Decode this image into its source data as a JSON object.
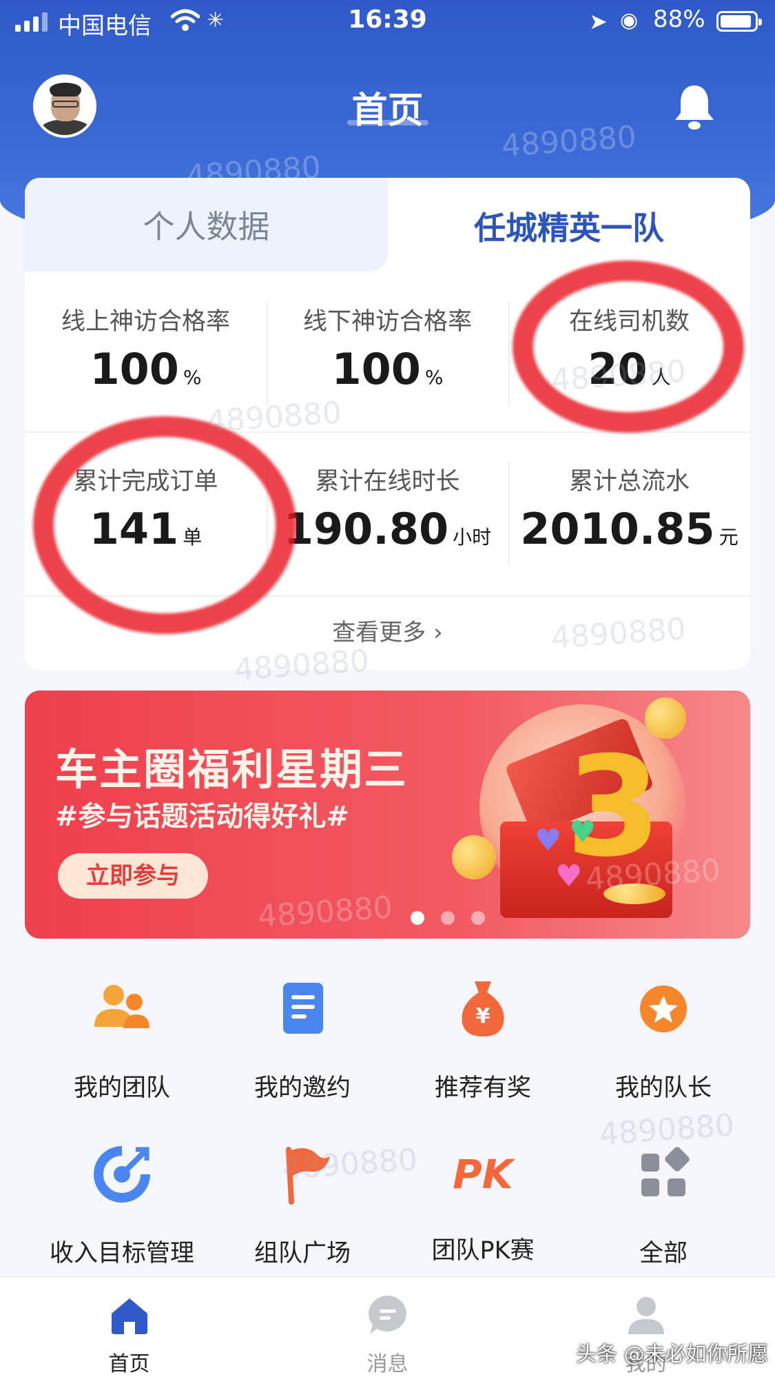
{
  "status_bar": {
    "carrier": "中国电信",
    "time": "16:39",
    "battery": "88%"
  },
  "header": {
    "title": "首页"
  },
  "card": {
    "tabs": [
      {
        "label": "个人数据"
      },
      {
        "label": "任城精英一队"
      }
    ],
    "stats": [
      {
        "label": "线上神访合格率",
        "value": "100",
        "unit": "%"
      },
      {
        "label": "线下神访合格率",
        "value": "100",
        "unit": "%"
      },
      {
        "label": "在线司机数",
        "value": "20",
        "unit": "人"
      },
      {
        "label": "累计完成订单",
        "value": "141",
        "unit": "单"
      },
      {
        "label": "累计在线时长",
        "value": "190.80",
        "unit": "小时"
      },
      {
        "label": "累计总流水",
        "value": "2010.85",
        "unit": "元"
      }
    ],
    "more": "查看更多 ›"
  },
  "banner": {
    "title": "车主圈福利星期三",
    "subtitle": "#参与话题活动得好礼#",
    "button": "立即参与",
    "graphic_digit": "3",
    "slide_count": 3,
    "active_slide": 0
  },
  "grid": [
    {
      "label": "我的团队",
      "icon": "team-icon"
    },
    {
      "label": "我的邀约",
      "icon": "invitation-doc-icon"
    },
    {
      "label": "推荐有奖",
      "icon": "money-bag-icon"
    },
    {
      "label": "我的队长",
      "icon": "star-badge-icon"
    },
    {
      "label": "收入目标管理",
      "icon": "target-icon"
    },
    {
      "label": "组队广场",
      "icon": "flag-icon"
    },
    {
      "label": "团队PK赛",
      "icon": "pk-icon",
      "icon_text": "PK"
    },
    {
      "label": "全部",
      "icon": "all-apps-icon"
    }
  ],
  "bottom_nav": [
    {
      "label": "首页",
      "icon": "home-icon",
      "active": true
    },
    {
      "label": "消息",
      "icon": "message-icon",
      "active": false
    },
    {
      "label": "我的",
      "icon": "profile-icon",
      "active": false
    }
  ],
  "watermark": "4890880",
  "credit": "头条 @未必如你所愿",
  "colors": {
    "primary": "#2f59c8",
    "accent_orange": "#f5862a",
    "tab_active": "#2b55b8",
    "banner_red": "#ef3f4e",
    "annotation_red": "#e81822"
  }
}
